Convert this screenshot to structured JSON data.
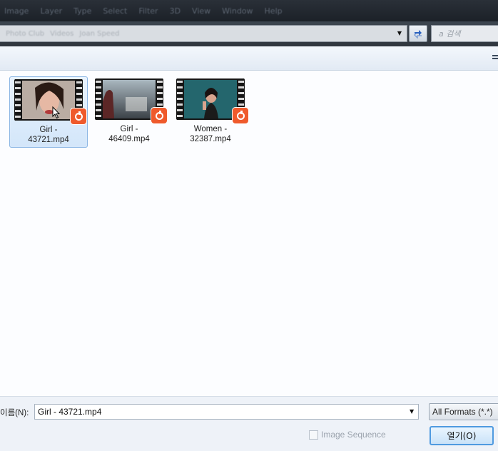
{
  "menubar": {
    "items": [
      "Image",
      "Layer",
      "Type",
      "Select",
      "Filter",
      "3D",
      "View",
      "Window",
      "Help"
    ]
  },
  "address": {
    "crumbs": [
      "Photo Club",
      "Videos",
      "Joan Speed"
    ]
  },
  "search": {
    "placeholder": "a 검색"
  },
  "files": [
    {
      "name_line1": "Girl -",
      "name_line2": "43721.mp4",
      "selected": true
    },
    {
      "name_line1": "Girl -",
      "name_line2": "46409.mp4",
      "selected": false
    },
    {
      "name_line1": "Women -",
      "name_line2": "32387.mp4",
      "selected": false
    }
  ],
  "bottom": {
    "filename_label": "이름(N):",
    "filename_value": "Girl - 43721.mp4",
    "filter_label": "All Formats (*.*)",
    "image_sequence_label": "Image Sequence",
    "open_label": "열기(O)"
  },
  "colors": {
    "badge": "#ef5a2c",
    "selection": "#d3e6fa",
    "open_button_border": "#4f9ae0"
  }
}
